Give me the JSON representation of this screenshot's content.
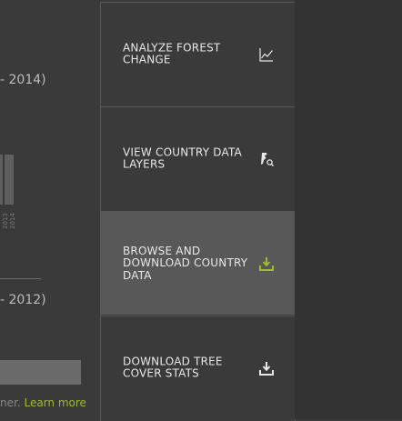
{
  "left": {
    "range_top": "- 2014)",
    "range_bottom": "- 2012)",
    "years": [
      "2013",
      "2014"
    ],
    "footer_text": "ner.",
    "learn_more": "Learn more"
  },
  "menu": {
    "items": [
      {
        "label": "ANALYZE FOREST CHANGE",
        "icon": "line-chart-icon",
        "active": false
      },
      {
        "label": "VIEW COUNTRY DATA LAYERS",
        "icon": "country-layers-icon",
        "active": false
      },
      {
        "label": "BROWSE AND DOWNLOAD COUNTRY DATA",
        "icon": "download-icon",
        "active": true
      },
      {
        "label": "DOWNLOAD TREE COVER STATS",
        "icon": "download-icon",
        "active": false
      }
    ]
  },
  "colors": {
    "accent": "#9ebc2e",
    "active_bg": "#585858",
    "panel_bg": "#3a3a3a"
  }
}
